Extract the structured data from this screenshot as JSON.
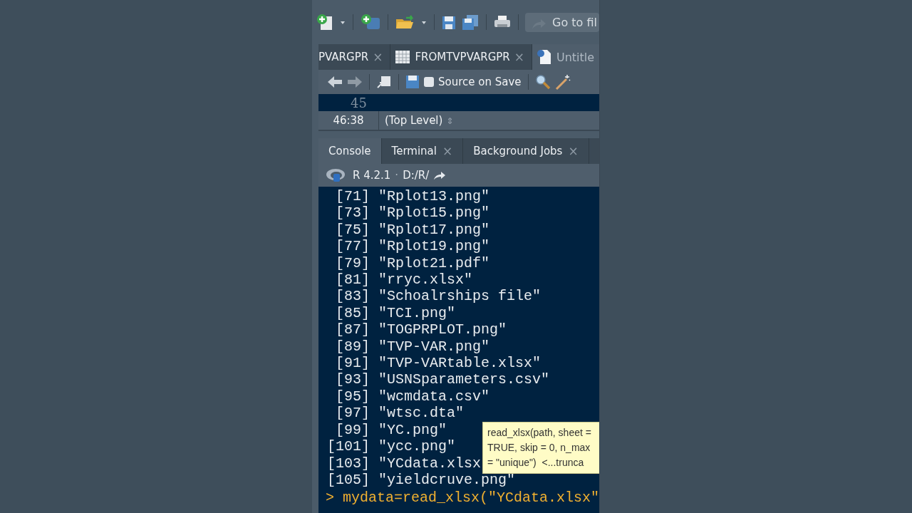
{
  "toolbar": {
    "goto_placeholder": "Go to fil"
  },
  "editor_tabs": [
    {
      "label": "PVARGPR",
      "kind": "plain",
      "selected": false,
      "close": "×"
    },
    {
      "label": "FROMTVPVARGPR",
      "kind": "table",
      "selected": false,
      "close": "×"
    },
    {
      "label": "Untitle",
      "kind": "script",
      "selected": true
    }
  ],
  "editor_toolbar": {
    "source_on_save": {
      "label": "Source on Save",
      "checked": false
    }
  },
  "editor": {
    "line_number": "45"
  },
  "status": {
    "position": "46:38",
    "scope": "(Top Level)",
    "scope_arrow": "⇕"
  },
  "console_tabs": [
    {
      "label": "Console",
      "selected": true
    },
    {
      "label": "Terminal",
      "selected": false,
      "close": "×"
    },
    {
      "label": "Background Jobs",
      "selected": false,
      "close": "×"
    }
  ],
  "console_header": {
    "version": "R 4.2.1",
    "separator": "·",
    "path": "D:/R/"
  },
  "output": [
    {
      "index": "[71]",
      "value": "\"Rplot13.png\""
    },
    {
      "index": "[73]",
      "value": "\"Rplot15.png\""
    },
    {
      "index": "[75]",
      "value": "\"Rplot17.png\""
    },
    {
      "index": "[77]",
      "value": "\"Rplot19.png\""
    },
    {
      "index": "[79]",
      "value": "\"Rplot21.pdf\""
    },
    {
      "index": "[81]",
      "value": "\"rryc.xlsx\""
    },
    {
      "index": "[83]",
      "value": "\"Schoalrships file\""
    },
    {
      "index": "[85]",
      "value": "\"TCI.png\""
    },
    {
      "index": "[87]",
      "value": "\"TOGPRPLOT.png\""
    },
    {
      "index": "[89]",
      "value": "\"TVP-VAR.png\""
    },
    {
      "index": "[91]",
      "value": "\"TVP-VARtable.xlsx\""
    },
    {
      "index": "[93]",
      "value": "\"USNSparameters.csv\""
    },
    {
      "index": "[95]",
      "value": "\"wcmdata.csv\""
    },
    {
      "index": "[97]",
      "value": "\"wtsc.dta\""
    },
    {
      "index": "[99]",
      "value": "\"YC.png\""
    },
    {
      "index": "[101]",
      "value": "\"ycc.png\""
    },
    {
      "index": "[103]",
      "value": "\"YCdata.xlsx"
    },
    {
      "index": "[105]",
      "value": "\"yieldcruve.png\""
    }
  ],
  "prompt": {
    "symbol": ">",
    "command": "mydata=read_xlsx(\"YCdata.xlsx\""
  },
  "tooltip": {
    "lines": [
      "read_xlsx(path, sheet =",
      "TRUE, skip = 0, n_max",
      "= \"unique\")  <...trunca"
    ]
  }
}
